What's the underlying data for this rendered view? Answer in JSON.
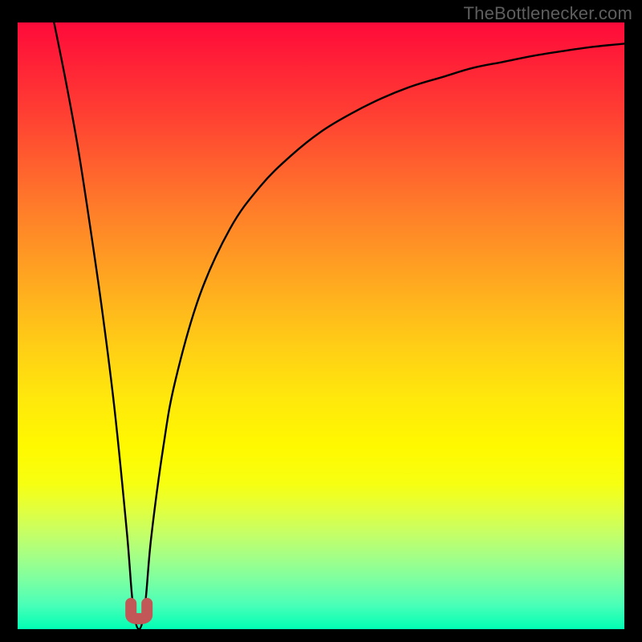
{
  "attribution": "TheBottlenecker.com",
  "chart_data": {
    "type": "line",
    "title": "",
    "xlabel": "",
    "ylabel": "",
    "xlim": [
      0,
      100
    ],
    "ylim": [
      0,
      100
    ],
    "series": [
      {
        "name": "bottleneck-curve",
        "x": [
          6,
          8,
          10,
          12,
          14,
          16,
          18,
          19,
          20,
          21,
          22,
          24,
          26,
          30,
          35,
          40,
          45,
          50,
          55,
          60,
          65,
          70,
          75,
          80,
          85,
          90,
          95,
          100
        ],
        "values": [
          100,
          90,
          79,
          66,
          52,
          36,
          16,
          4,
          0,
          4,
          15,
          30,
          41,
          55,
          66,
          73,
          78,
          82,
          85,
          87.5,
          89.5,
          91,
          92.5,
          93.5,
          94.5,
          95.3,
          96,
          96.5
        ]
      }
    ],
    "marker": {
      "name": "optimal-point",
      "x": 20,
      "y": 0,
      "color": "#c25757"
    },
    "gradient_stops": [
      {
        "pos": 0,
        "color": "#ff0a3a"
      },
      {
        "pos": 50,
        "color": "#ffd015"
      },
      {
        "pos": 75,
        "color": "#fff900"
      },
      {
        "pos": 100,
        "color": "#00ffb4"
      }
    ]
  }
}
